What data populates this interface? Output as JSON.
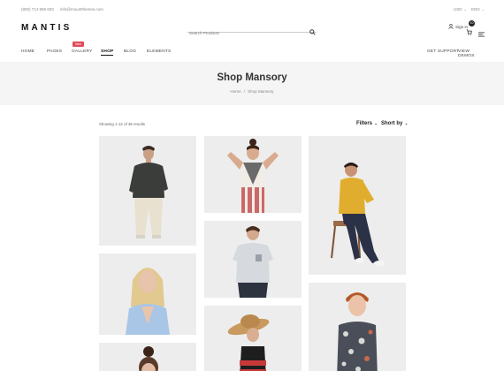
{
  "topbar": {
    "phone": "(800) 714 859 833",
    "email": "info@mountthemes.com",
    "currency": "USD",
    "language": "ENG"
  },
  "header": {
    "logo": "MANTIS",
    "search_placeholder": "Search Products",
    "signin_label": "Sign in",
    "cart_count": "10"
  },
  "nav": {
    "items": [
      "HOME",
      "PAGES",
      "GALLERY",
      "SHOP",
      "BLOG",
      "ELEMENTS"
    ],
    "active": "SHOP",
    "new_badge": "New",
    "right_items": [
      "GET SUPPORT",
      "VIEW DEMOS"
    ]
  },
  "hero": {
    "title": "Shop Mansory",
    "breadcrumb": [
      "Home",
      "/",
      "Shop Mansory"
    ]
  },
  "toolbar": {
    "results": "Showing 1-12 of 36 results",
    "filters_label": "Filters",
    "sort_label": "Short by"
  },
  "products": [
    {
      "name": "man-black-polo"
    },
    {
      "name": "girl-geometric-dress"
    },
    {
      "name": "man-yellow-polo-chair"
    },
    {
      "name": "woman-blue-blazer"
    },
    {
      "name": "boy-grey-tshirt"
    },
    {
      "name": "boy-floral-shirt"
    },
    {
      "name": "woman-straw-hat"
    },
    {
      "name": "girl-bun-hair"
    }
  ],
  "colors": {
    "accent": "#e04a5a",
    "hero_bg": "#f5f5f5",
    "text_dark": "#222222"
  }
}
